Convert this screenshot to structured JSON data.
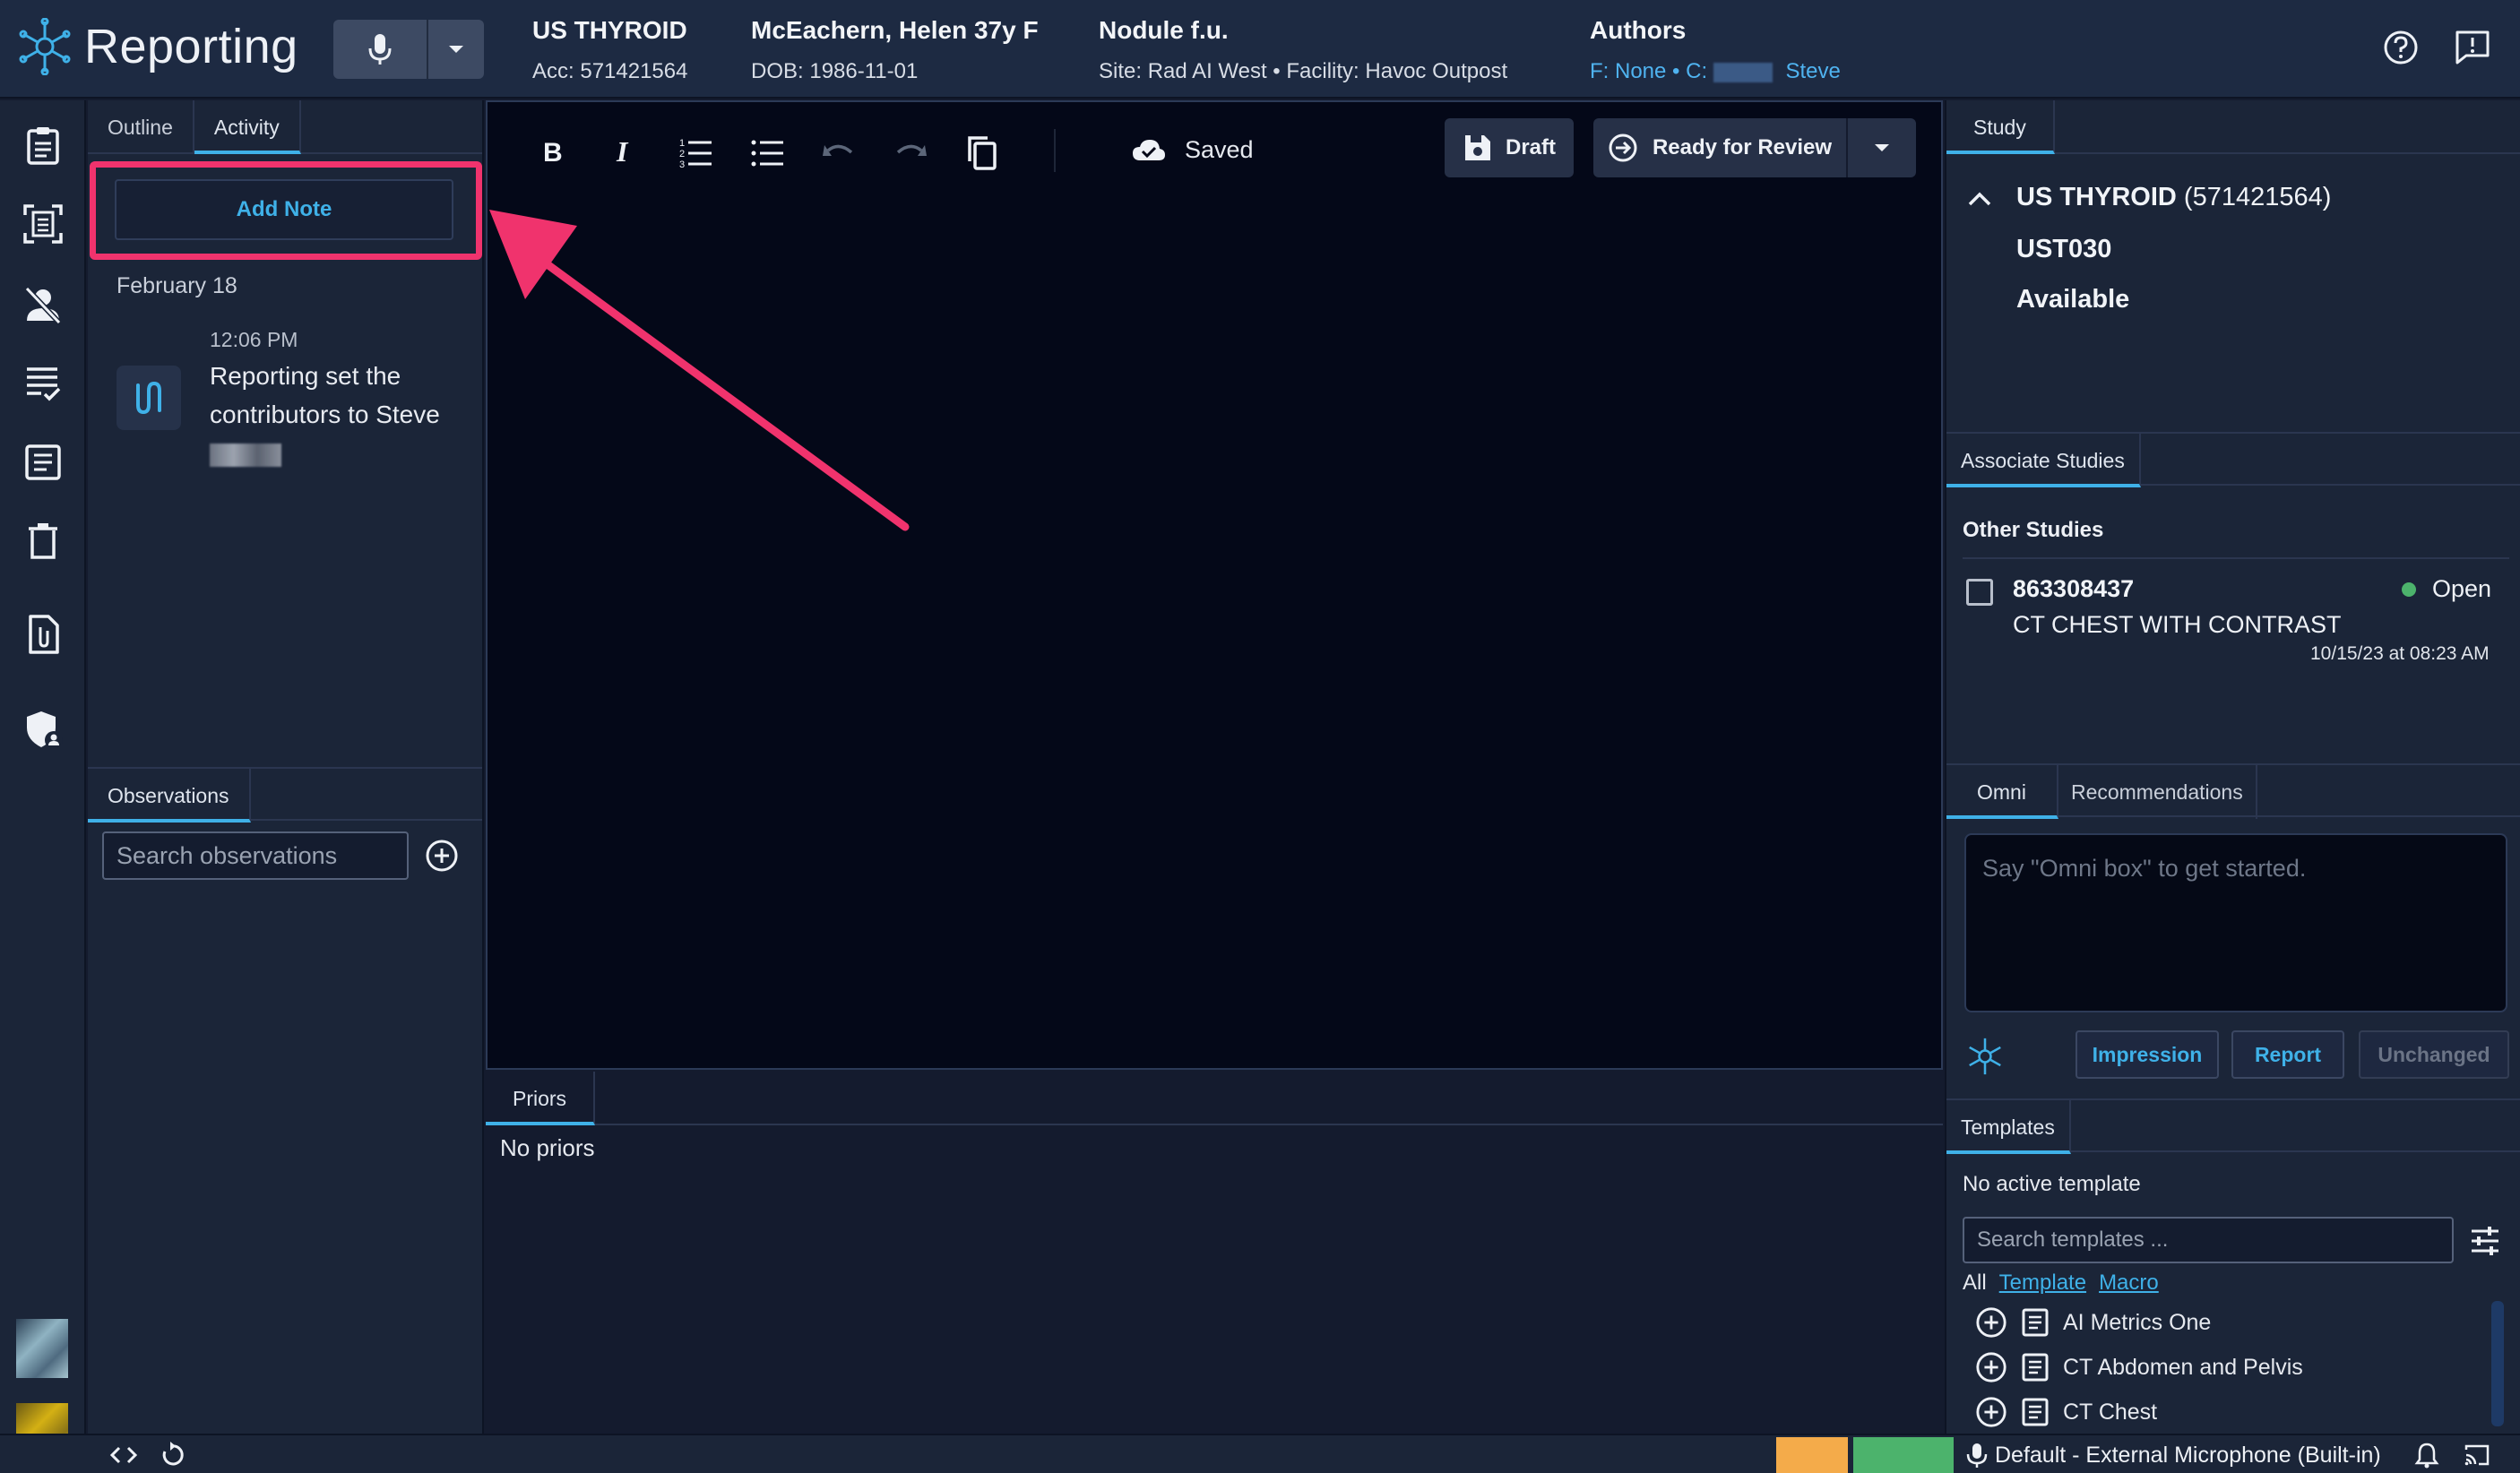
{
  "app": {
    "title": "Reporting"
  },
  "header": {
    "exam": {
      "title": "US THYROID",
      "sub": "Acc: 571421564"
    },
    "patient": {
      "title": "McEachern, Helen 37y F",
      "sub": "DOB: 1986-11-01"
    },
    "reason": {
      "title": "Nodule f.u.",
      "sub": "Site: Rad AI West • Facility: Havoc Outpost"
    },
    "authors": {
      "title": "Authors",
      "sub": "F: None • C:",
      "name": "Steve"
    }
  },
  "left_panel": {
    "tabs": [
      "Outline",
      "Activity"
    ],
    "add_note_label": "Add Note",
    "date": "February 18",
    "activity": {
      "time": "12:06 PM",
      "text": "Reporting set the contributors to Steve"
    },
    "observations_tab": "Observations",
    "search_placeholder": "Search observations"
  },
  "toolbar": {
    "saved_label": "Saved",
    "draft_label": "Draft",
    "review_label": "Ready for Review"
  },
  "priors": {
    "tab": "Priors",
    "empty": "No priors"
  },
  "right_panel": {
    "study_tab": "Study",
    "study": {
      "name": "US THYROID",
      "acc": "(571421564)",
      "code": "UST030",
      "status": "Available"
    },
    "associate_tab": "Associate Studies",
    "other_studies_title": "Other Studies",
    "other_study": {
      "id": "863308437",
      "status": "Open",
      "desc": "CT CHEST WITH CONTRAST",
      "date": "10/15/23 at 08:23 AM"
    },
    "omni_tabs": [
      "Omni",
      "Recommendations"
    ],
    "omni_placeholder": "Say \"Omni box\" to get started.",
    "omni_buttons": [
      "Impression",
      "Report",
      "Unchanged"
    ],
    "templates_tab": "Templates",
    "no_active": "No active template",
    "template_search_placeholder": "Search templates ...",
    "filters": {
      "all": "All",
      "template": "Template",
      "macro": "Macro"
    },
    "templates": [
      "AI Metrics One",
      "CT Abdomen and Pelvis",
      "CT Chest"
    ]
  },
  "statusbar": {
    "mic_label": "Default - External Microphone (Built-in)"
  },
  "colors": {
    "accent": "#3fb1e8",
    "highlight": "#f0336d",
    "open_status": "#4cb36c"
  }
}
